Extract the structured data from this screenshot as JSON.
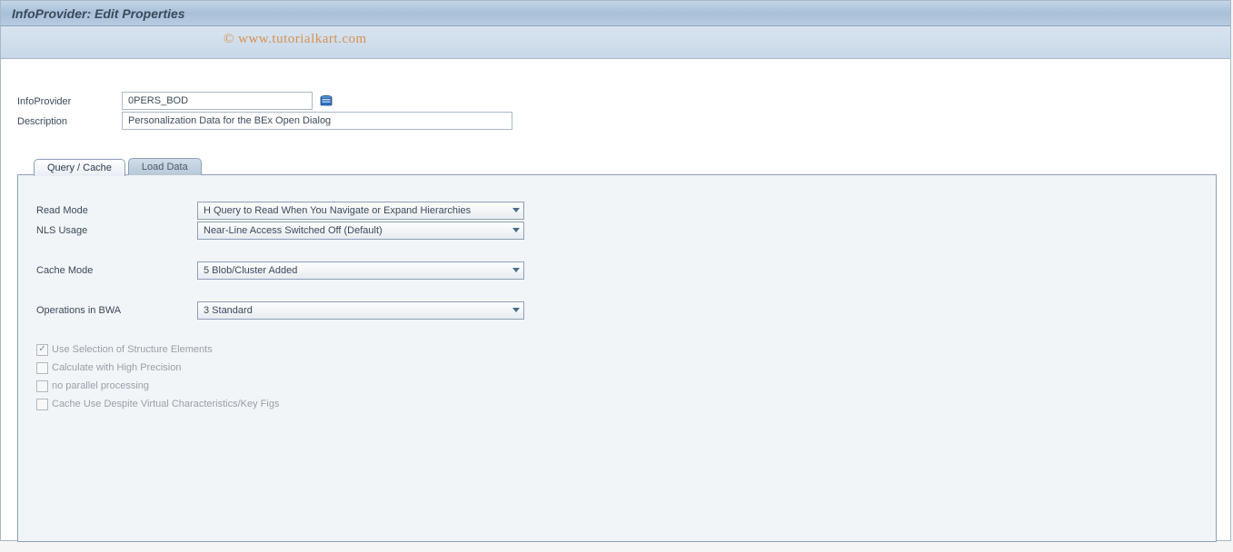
{
  "window": {
    "title": "InfoProvider: Edit Properties"
  },
  "watermark": "© www.tutorialkart.com",
  "header": {
    "infoprovider_label": "InfoProvider",
    "infoprovider_value": "0PERS_BOD",
    "description_label": "Description",
    "description_value": "Personalization Data for the BEx Open Dialog"
  },
  "tabs": [
    {
      "label": "Query / Cache",
      "active": true
    },
    {
      "label": "Load Data",
      "active": false
    }
  ],
  "panel": {
    "read_mode_label": "Read Mode",
    "read_mode_value": "H Query to Read When You Navigate or Expand Hierarchies",
    "nls_label": "NLS Usage",
    "nls_value": "Near-Line Access Switched Off (Default)",
    "cache_mode_label": "Cache Mode",
    "cache_mode_value": "5 Blob/Cluster Added",
    "ops_bwa_label": "Operations in BWA",
    "ops_bwa_value": "3 Standard"
  },
  "checkboxes": [
    {
      "label": "Use Selection of Structure Elements",
      "checked": true
    },
    {
      "label": "Calculate with High Precision",
      "checked": false
    },
    {
      "label": "no parallel processing",
      "checked": false
    },
    {
      "label": "Cache Use Despite Virtual Characteristics/Key Figs",
      "checked": false
    }
  ]
}
